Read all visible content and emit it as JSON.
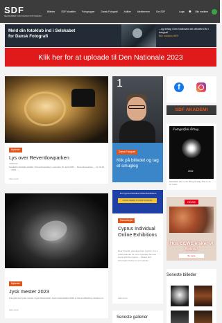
{
  "nav": {
    "logo": "SDF",
    "logo_sub": "SELSKABET FOR DANSK FOTOGRAFI",
    "items": [
      "Billeder",
      "SDF Modeller",
      "Fotogrupper",
      "Dansk Fotografi",
      "Artikler",
      "Medlemmer",
      "Om SDF",
      "Kalender"
    ],
    "login": "Login",
    "become_member": "Bliv medlem"
  },
  "promo": {
    "left": "Meld din fotoklub ind i Selskabet for Dansk Fotografi",
    "right": "...og deltag i Den Nationale det officielle DM i fotografi.",
    "right_link": "Bliv medlem HER"
  },
  "cta": "Klik her for at uploade til Den Nationale 2023",
  "post1": {
    "tag": "Nyheder",
    "title": "Lys over Reventlowparken",
    "meta": "Jubilæum",
    "excerpt": "Selskab's fotoklub udstiller i Reventlowparken i perioden 10. april 2023 ... Reventlowparken ... kl. 10-19 ... 2023 ...",
    "readmore": "Læs mere"
  },
  "ad_man": {
    "number": "1",
    "tag": "Dansk Fotografi",
    "text": "Klik på billedet og tag et smugkig"
  },
  "social": {
    "facebook": "f",
    "instagram": "instagram"
  },
  "akademi": "SDF AKADEMI",
  "aarbog": {
    "title": "Fotografisk Årbog",
    "year": "2022",
    "caption": "Selskabet har nu sin årbog til salg. Pris er ca. Kr. mere"
  },
  "post2": {
    "tag": "Nyheder",
    "title": "Jysk mester 2023",
    "excerpt": "Fotograf ved Jyske mester i Jysk Mesterskab. Jysk mesterskabet 2023 er blevet afholdt og vinderen er ...",
    "readmore": "Læs mere"
  },
  "cyprus": {
    "banner_line": "1st Cyprus Individual Online Exhibitions",
    "banner_button": "CLICK HERE TO PARTICIPATE",
    "tag": "Samarbejde",
    "title": "Cyprus Individual Online Exhibitions",
    "text": "Dear Friends, greetings from Cyprus. It is a great pleasure for us to organise this new event with the Cyprus ... Please find information below on our website ...",
    "readmore": "Læs mere"
  },
  "cewe": {
    "logo": "CEWE",
    "text": "Hos CEWE elsker vi fotos!",
    "button": "Se mere"
  },
  "latest": {
    "title": "Seneste billeder"
  },
  "galleries": {
    "title": "Seneste gallerier"
  },
  "colors": {
    "nav_bg": "#3c3c3c",
    "cta_red": "#e01a1a",
    "tag_orange": "#e2541a",
    "ad_blue": "#3a86c8",
    "cyprus_blue": "#1e3fa3"
  }
}
